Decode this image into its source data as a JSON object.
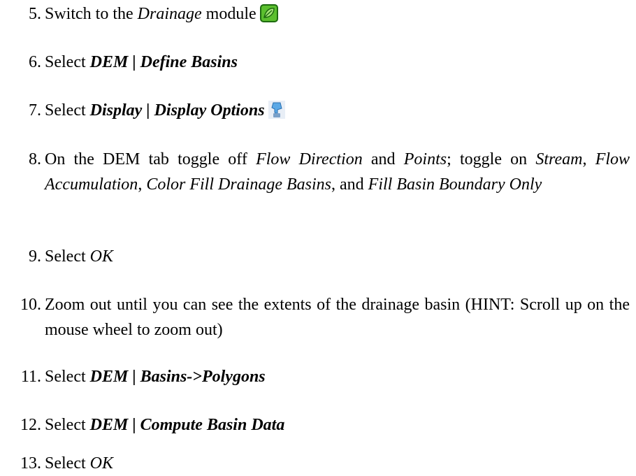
{
  "steps": [
    {
      "num": "5.",
      "pre": "Switch to the ",
      "em": "Drainage",
      "post": " module",
      "icon": "drainage-module-icon"
    },
    {
      "num": "6.",
      "pre": "Select ",
      "bold": "DEM | Define Basins"
    },
    {
      "num": "7.",
      "pre": "Select ",
      "bold": "Display | Display Options",
      "icon": "display-options-icon"
    },
    {
      "num": "8.",
      "t1": "On the DEM tab toggle off ",
      "e1": "Flow Direction",
      "t2": " and ",
      "e2": "Points",
      "t3": "; toggle on ",
      "e3": "Stream",
      "t4": ", ",
      "e4": "Flow Accumulation",
      "t5": ", ",
      "e5": "Color Fill Drainage Basins",
      "t6": ", and ",
      "e6": "Fill Basin Boundary Only"
    },
    {
      "num": "9.",
      "pre": "Select ",
      "em": "OK"
    },
    {
      "num": "10.",
      "text": "Zoom out until you can see the extents of the drainage basin (HINT: Scroll up on the mouse wheel to zoom out)"
    },
    {
      "num": "11.",
      "pre": "Select ",
      "bold": "DEM | Basins->Polygons"
    },
    {
      "num": "12.",
      "pre": "Select ",
      "bold": "DEM | Compute Basin Data"
    },
    {
      "num": "13.",
      "pre": "Select ",
      "em": "OK"
    }
  ],
  "colors": {
    "drainage_icon_fill": "#5bbf2e",
    "drainage_icon_border": "#1e6b10",
    "display_icon_fill": "#5aa8e6"
  }
}
